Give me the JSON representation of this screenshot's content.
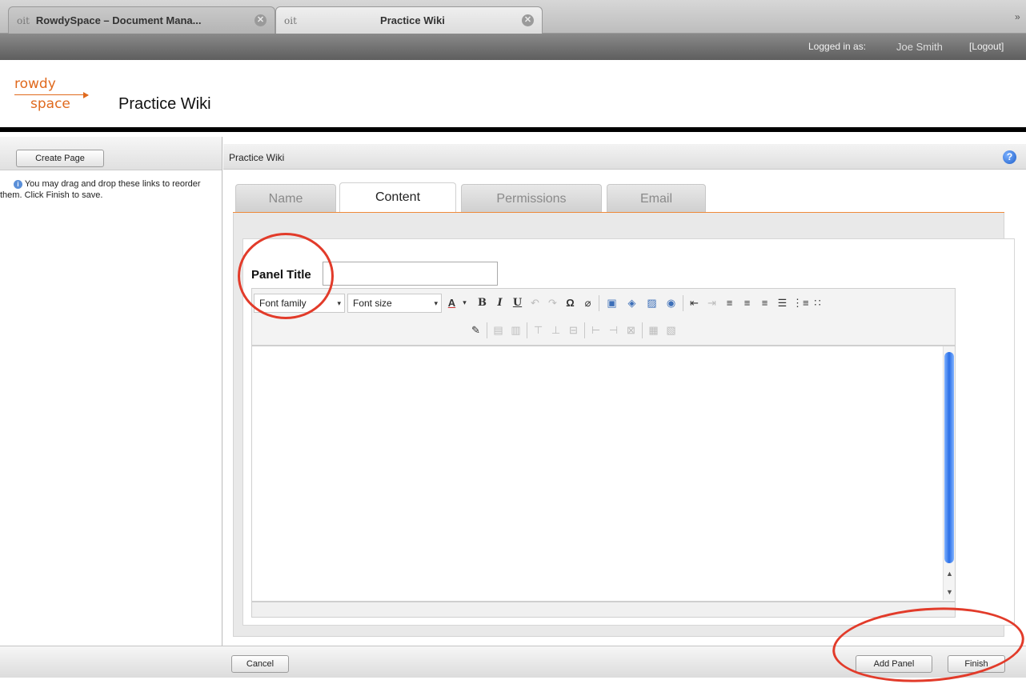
{
  "browser": {
    "tabs": [
      {
        "favicon": "oit",
        "label": "RowdySpace – Document Mana...",
        "active": false
      },
      {
        "favicon": "oit",
        "label": "Practice Wiki",
        "active": true
      }
    ],
    "close_glyph": "✕",
    "overflow_glyph": "»"
  },
  "userbar": {
    "logged_in_label": "Logged in as:",
    "user_name": "Joe Smith",
    "logout_label": "[Logout]"
  },
  "header": {
    "logo_line1": "rowdy",
    "logo_line2": "space",
    "site_title": "Practice Wiki"
  },
  "sidebar": {
    "create_page_label": "Create Page",
    "hint_text": "You may drag and drop these links to reorder them. Click Finish to save."
  },
  "main": {
    "title": "Practice Wiki",
    "help_glyph": "?",
    "tabs": [
      {
        "label": "Name",
        "active": false
      },
      {
        "label": "Content",
        "active": true
      },
      {
        "label": "Permissions",
        "active": false
      },
      {
        "label": "Email",
        "active": false
      }
    ],
    "panel_title_label": "Panel Title",
    "panel_title_value": ""
  },
  "editor": {
    "font_family_label": "Font family",
    "font_size_label": "Font size",
    "dropdown_glyph": "▾",
    "toolbar_row1_icons": [
      "font-color-icon",
      "bold-icon",
      "italic-icon",
      "underline-icon",
      "undo-icon",
      "redo-icon",
      "special-char-icon",
      "remove-format-icon",
      "image-icon",
      "media-icon",
      "photo-icon",
      "link-icon",
      "outdent-icon",
      "indent-icon",
      "align-left-icon",
      "align-center-icon",
      "align-right-icon",
      "align-justify-icon",
      "ordered-list-icon",
      "unordered-list-icon"
    ],
    "toolbar_row2_icons": [
      "edit-table-icon",
      "table-row-icon",
      "table-col-icon",
      "insert-row-before-icon",
      "insert-row-after-icon",
      "delete-row-icon",
      "insert-col-before-icon",
      "insert-col-after-icon",
      "delete-col-icon",
      "merge-cells-icon",
      "split-cells-icon"
    ]
  },
  "footer": {
    "cancel_label": "Cancel",
    "add_panel_label": "Add Panel",
    "finish_label": "Finish"
  },
  "colors": {
    "brand_orange": "#e06a1e",
    "annotation_red": "#e23b2a",
    "accent_blue": "#2a6ee6"
  }
}
